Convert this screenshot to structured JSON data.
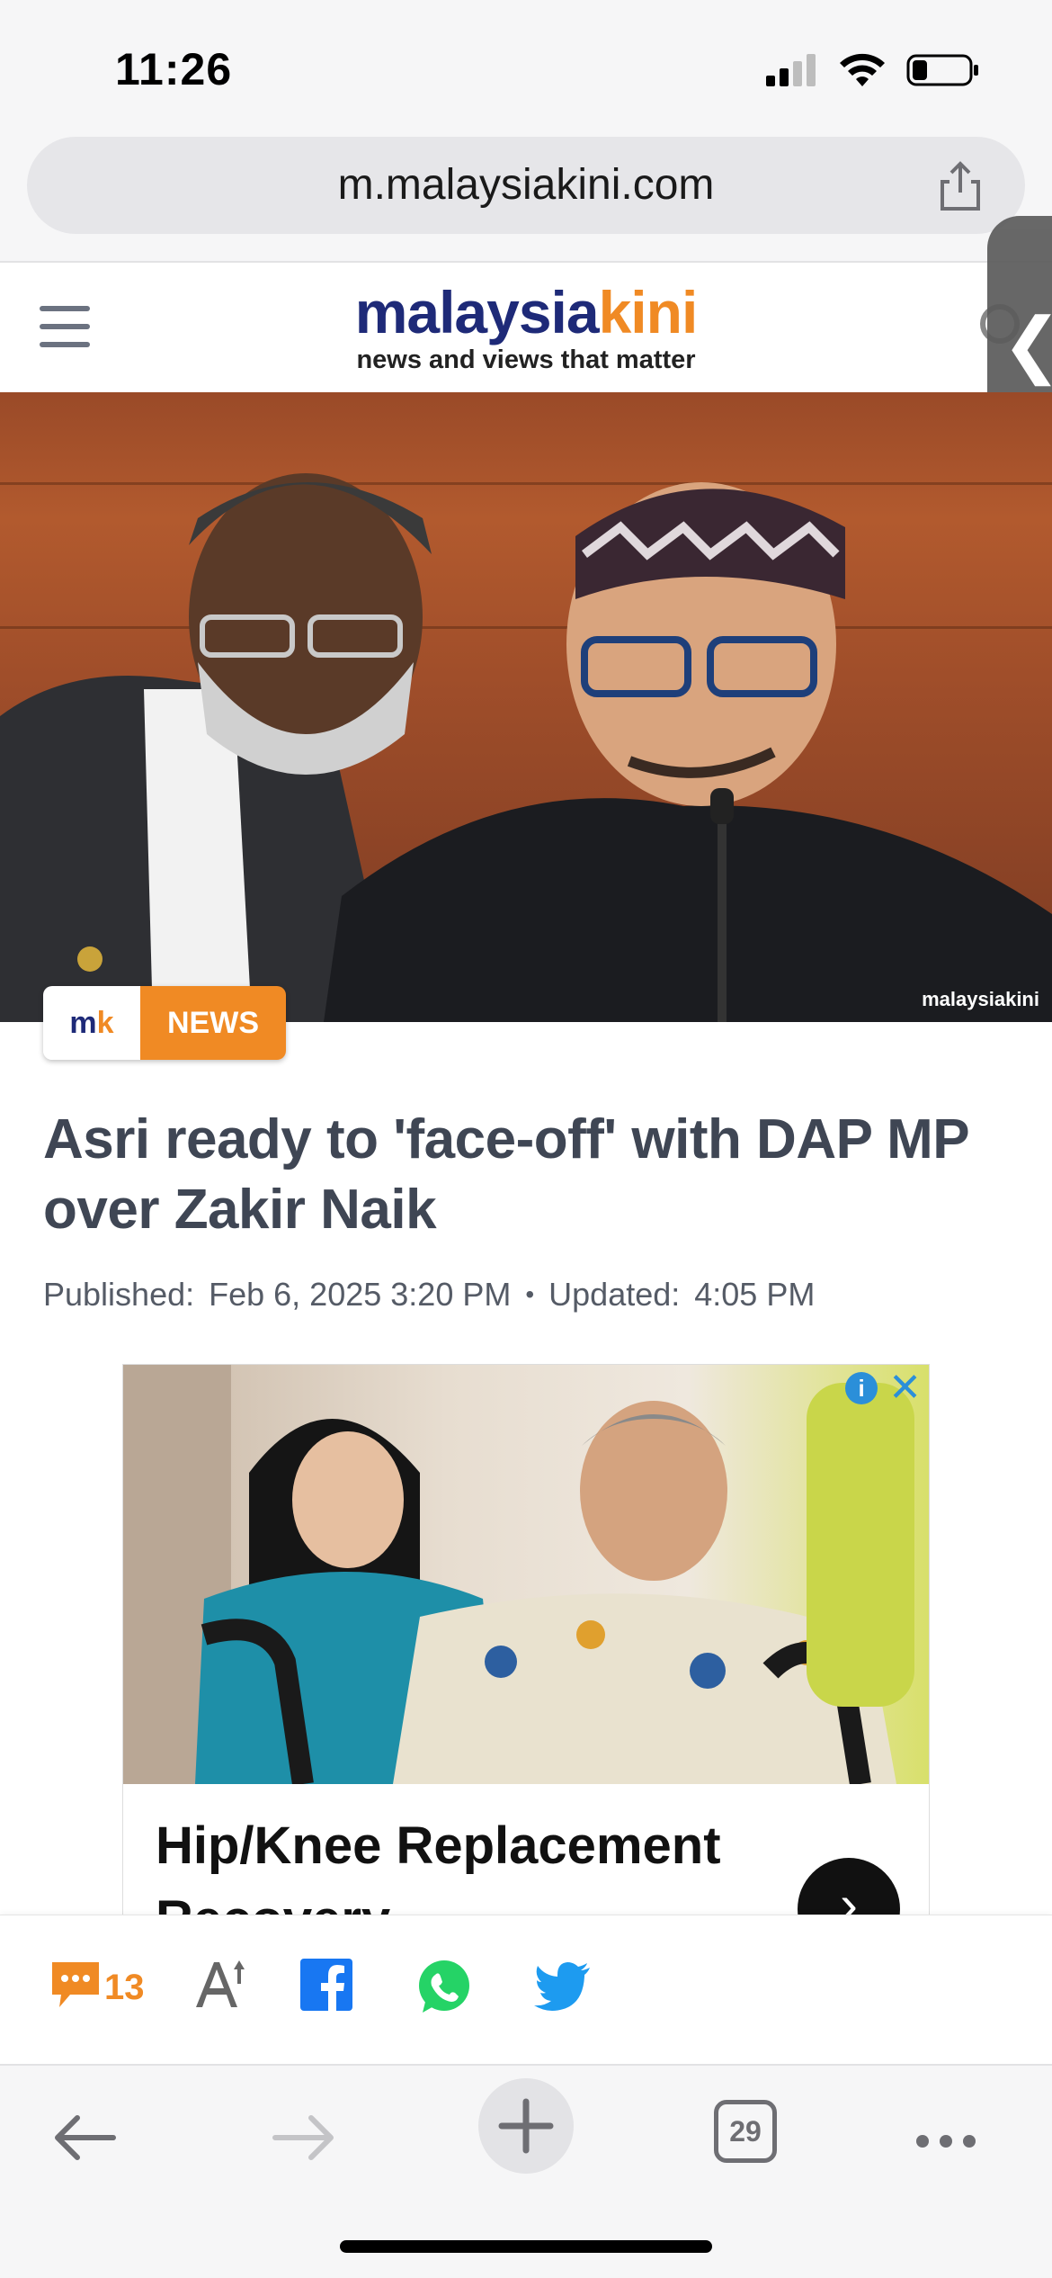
{
  "status_bar": {
    "time": "11:26",
    "icons": [
      "cellular-signal-icon",
      "wifi-icon",
      "battery-icon"
    ]
  },
  "browser": {
    "url": "m.malaysiakini.com",
    "tab_count": "29"
  },
  "site": {
    "logo_part1": "malaysia",
    "logo_part2": "kini",
    "tagline": "news and views that matter",
    "colors": {
      "brand_navy": "#1e2a78",
      "brand_orange": "#f08a24"
    }
  },
  "hero": {
    "watermark": "malaysiakini"
  },
  "article": {
    "badge_logo_a": "m",
    "badge_logo_b": "k",
    "category": "NEWS",
    "title": "Asri ready to 'face-off' with DAP MP over Zakir Naik",
    "published_label": "Published:",
    "published_value": "Feb 6, 2025 3:20 PM",
    "separator": "•",
    "updated_label": "Updated:",
    "updated_value": "4:05 PM"
  },
  "ad": {
    "info_label": "i",
    "close_label": "✕",
    "title": "Hip/Knee Replacement Recovery",
    "next_label": "›"
  },
  "share_bar": {
    "comment_count": "13",
    "icons": [
      "comment-icon",
      "text-size-icon",
      "facebook-icon",
      "whatsapp-icon",
      "twitter-icon"
    ]
  },
  "side_tab": {
    "label": "❮"
  }
}
